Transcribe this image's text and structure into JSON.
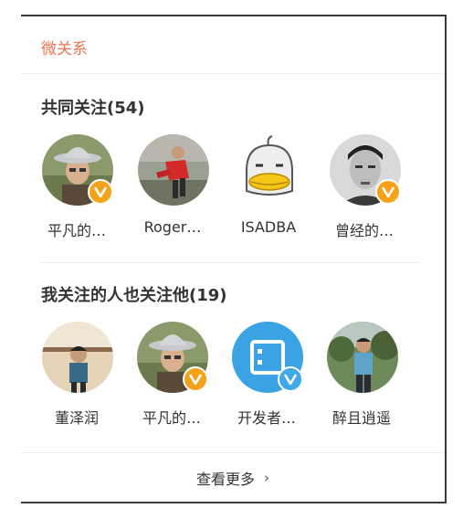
{
  "header": {
    "title": "微关系"
  },
  "common_follow": {
    "title": "共同关注(54)",
    "users": [
      {
        "name": "平凡的…",
        "verified": "orange",
        "avatar": "hat-man"
      },
      {
        "name": "Roger…",
        "verified": "none",
        "avatar": "red-jacket"
      },
      {
        "name": "ISADBA",
        "verified": "none",
        "avatar": "cartoon-duck"
      },
      {
        "name": "曾经的…",
        "verified": "orange",
        "avatar": "bw-portrait"
      }
    ]
  },
  "also_follow": {
    "title": "我关注的人也关注他(19)",
    "users": [
      {
        "name": "董泽润",
        "verified": "none",
        "avatar": "boy-outdoor"
      },
      {
        "name": "平凡的…",
        "verified": "orange",
        "avatar": "hat-man"
      },
      {
        "name": "开发者…",
        "verified": "blue",
        "avatar": "blue-logo"
      },
      {
        "name": "醉且逍遥",
        "verified": "none",
        "avatar": "man-park"
      }
    ]
  },
  "footer": {
    "more_label": "查看更多",
    "chevron": "›"
  },
  "colors": {
    "accent": "#eb7350",
    "badge_orange": "#f5a21b",
    "badge_blue": "#3ea8e8"
  }
}
